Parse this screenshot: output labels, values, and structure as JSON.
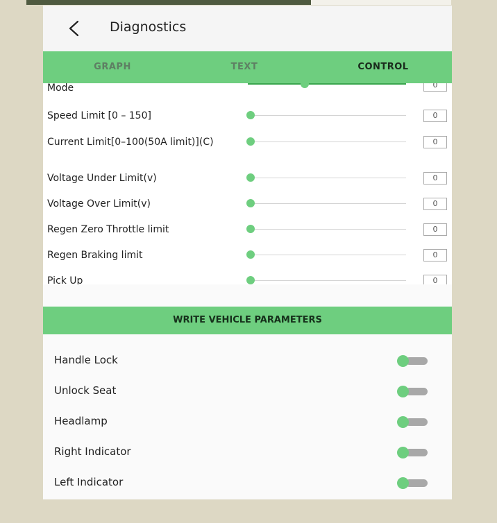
{
  "app": {
    "title": "Diagnostics"
  },
  "tabs": [
    {
      "label": "GRAPH",
      "selected": false
    },
    {
      "label": "TEXT",
      "selected": false
    },
    {
      "label": "CONTROL",
      "selected": true
    }
  ],
  "parameters": [
    {
      "label": "Mode",
      "value": "0",
      "level": 0.34
    },
    {
      "label": "Speed Limit [0 – 150]",
      "value": "0",
      "level": 0
    },
    {
      "label": "Current Limit[0–100(50A limit)](C)",
      "value": "0",
      "level": 0
    },
    {
      "label": "Voltage Under Limit(v)",
      "value": "0",
      "level": 0
    },
    {
      "label": "Voltage Over Limit(v)",
      "value": "0",
      "level": 0
    },
    {
      "label": "Regen Zero Throttle limit",
      "value": "0",
      "level": 0
    },
    {
      "label": "Regen Braking limit",
      "value": "0",
      "level": 0
    },
    {
      "label": "Pick Up",
      "value": "0",
      "level": 0
    }
  ],
  "section": {
    "write_label": "WRITE VEHICLE PARAMETERS"
  },
  "switches": [
    {
      "label": "Handle Lock",
      "on": false
    },
    {
      "label": "Unlock Seat",
      "on": false
    },
    {
      "label": "Headlamp",
      "on": false
    },
    {
      "label": "Right Indicator",
      "on": false
    },
    {
      "label": "Left Indicator",
      "on": false
    }
  ],
  "colors": {
    "accent": "#6ece7f",
    "background": "#ddd8c4"
  },
  "icons": {
    "back": "chevron-left-icon"
  }
}
